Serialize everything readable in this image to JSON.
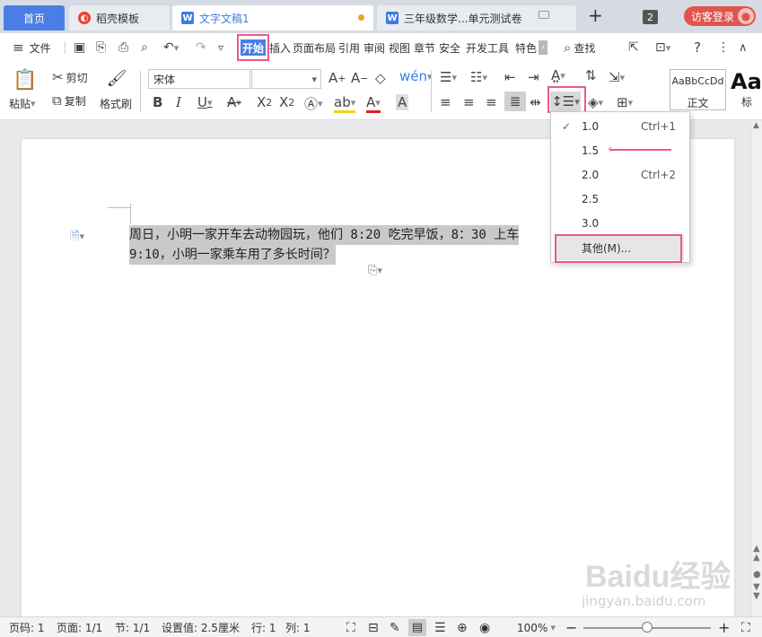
{
  "tabs": {
    "home": "首页",
    "daoke": "稻壳模板",
    "doc1": "文字文稿1",
    "doc2": "三年级数学...单元测试卷",
    "add": "+",
    "count": "2",
    "login": "访客登录"
  },
  "menu": {
    "file": "文件",
    "items": [
      "开始",
      "插入",
      "页面布局",
      "引用",
      "审阅",
      "视图",
      "章节",
      "安全",
      "开发工具",
      "特色"
    ],
    "find": "查找"
  },
  "ribbon": {
    "paste": "粘贴",
    "cut": "剪切",
    "copy": "复制",
    "format_painter": "格式刷",
    "font_name": "宋体",
    "font_size": "",
    "style_preview": "AaBbCcDd",
    "style_name": "正文",
    "style2_preview": "Aa",
    "style2_name": "标"
  },
  "document": {
    "line1": "周日，小明一家开车去动物园玩，他们 8:20 吃完早饭，8：30 上车",
    "line2": "9:10，小明一家乘车用了多长时间？"
  },
  "line_spacing_menu": {
    "options": [
      {
        "value": "1.0",
        "shortcut": "Ctrl+1",
        "checked": true
      },
      {
        "value": "1.5",
        "shortcut": "",
        "checked": false
      },
      {
        "value": "2.0",
        "shortcut": "Ctrl+2",
        "checked": false
      },
      {
        "value": "2.5",
        "shortcut": "",
        "checked": false
      },
      {
        "value": "3.0",
        "shortcut": "",
        "checked": false
      }
    ],
    "other": "其他(M)..."
  },
  "status": {
    "page": "页码: 1",
    "pages": "页面: 1/1",
    "section": "节: 1/1",
    "setting": "设置值: 2.5厘米",
    "row": "行: 1",
    "col": "列: 1",
    "zoom": "100%",
    "zoom_level": 0.5
  },
  "watermark": {
    "brand": "Baidu经验",
    "url": "jingyan.baidu.com"
  },
  "colors": {
    "accent": "#4a7ee6",
    "highlight": "#ea5a8a",
    "selection": "#c9c9c9"
  }
}
